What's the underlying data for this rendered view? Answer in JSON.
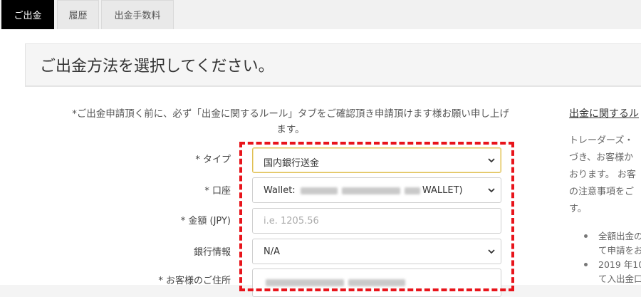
{
  "tabs": [
    {
      "label": "ご出金",
      "active": true
    },
    {
      "label": "履歴",
      "active": false
    },
    {
      "label": "出金手数料",
      "active": false
    }
  ],
  "page_title": "ご出金方法を選択してください。",
  "notice": {
    "line1": "*ご出金申請頂く前に、必ず「出金に関するルール」タブをご確認頂き申請頂けます様お願い申し上げ",
    "line2": "ます。"
  },
  "form": {
    "type": {
      "label": "* タイプ",
      "value": "国内銀行送金"
    },
    "account": {
      "label": "* 口座",
      "value_prefix": "Wallet: ",
      "value_suffix": "WALLET)"
    },
    "amount": {
      "label": "* 金額 (JPY)",
      "placeholder": "i.e. 1205.56"
    },
    "bank_info": {
      "label": "銀行情報",
      "value": "N/A"
    },
    "address": {
      "label": "* お客様のご住所"
    }
  },
  "sidebar": {
    "heading": "出金に関するル",
    "paragraph_lines": [
      "トレーダーズ・",
      "づき、お客様か",
      "おります。 お客",
      "の注意事項をご",
      "す。"
    ],
    "bullets": [
      [
        "全額出金の",
        "て申請をお"
      ],
      [
        "2019 年10",
        "て入出金口"
      ]
    ]
  },
  "colors": {
    "active_tab_bg": "#000000",
    "highlight_border": "#e8141b",
    "focused_select_border": "#e0bf55"
  }
}
